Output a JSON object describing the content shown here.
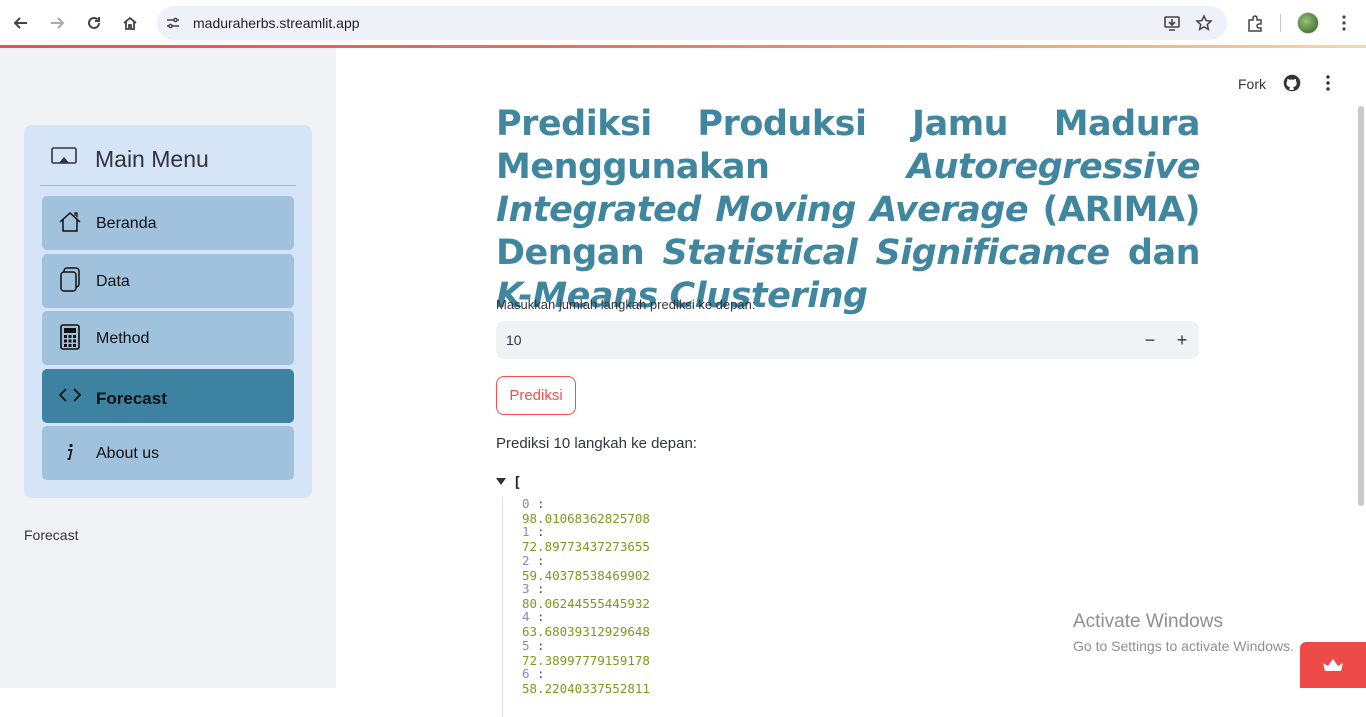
{
  "browser": {
    "url": "maduraherbs.streamlit.app",
    "icons": [
      "back-icon",
      "forward-icon",
      "reload-icon",
      "home-icon",
      "site-settings-icon",
      "install-icon",
      "bookmark-star-icon",
      "extensions-icon",
      "profile-avatar",
      "chrome-menu-icon"
    ]
  },
  "sidebar": {
    "menu_title": "Main Menu",
    "items": [
      {
        "label": "Beranda",
        "icon": "house-icon",
        "active": false
      },
      {
        "label": "Data",
        "icon": "copy-files-icon",
        "active": false
      },
      {
        "label": "Method",
        "icon": "calculator-icon",
        "active": false
      },
      {
        "label": "Forecast",
        "icon": "code-brackets-icon",
        "active": true
      },
      {
        "label": "About us",
        "icon": "info-icon",
        "active": false
      }
    ],
    "caption": "Forecast"
  },
  "toolbar": {
    "fork_label": "Fork"
  },
  "main": {
    "title_parts": {
      "p1": "Prediksi Produksi Jamu Madura Menggunakan",
      "p2": "Autoregressive Integrated Moving Average",
      "p3": "(ARIMA) Dengan",
      "p4": "Statistical Significance",
      "p5": "dan",
      "p6": "K-Means Clustering"
    },
    "input_label": "Masukkan jumlah langkah prediksi ke depan:",
    "input_value": "10",
    "minus_label": "−",
    "plus_label": "+",
    "button_label": "Prediksi",
    "result_label": "Prediksi 10 langkah ke depan:",
    "json_open": "[",
    "predictions": [
      {
        "index": "0",
        "value": "98.01068362825708"
      },
      {
        "index": "1",
        "value": "72.89773437273655"
      },
      {
        "index": "2",
        "value": "59.40378538469902"
      },
      {
        "index": "3",
        "value": "80.06244555445932"
      },
      {
        "index": "4",
        "value": "63.68039312929648"
      },
      {
        "index": "5",
        "value": "72.38997779159178"
      },
      {
        "index": "6",
        "value": "58.22040337552811"
      }
    ]
  },
  "watermark": {
    "title": "Activate Windows",
    "subtitle": "Go to Settings to activate Windows."
  },
  "colors": {
    "accent": "#40869f",
    "menu_bg": "#d6e4f7",
    "menu_item": "#a1c2dd",
    "menu_active": "#3d83a1",
    "button_red": "#ff4b4b"
  }
}
